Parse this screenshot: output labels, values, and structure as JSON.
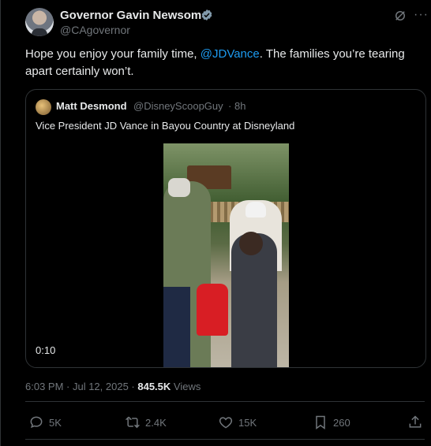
{
  "tweet": {
    "author_name": "Governor Gavin Newsom",
    "author_handle": "@CAgovernor",
    "text_before": "Hope you enjoy your family time, ",
    "mention": "@JDVance",
    "text_after": ". The families you’re tearing apart certainly won’t.",
    "date_time": "6:03 PM · Jul 12, 2025 · ",
    "views_count": "845.5K",
    "views_label": " Views"
  },
  "quote": {
    "author_name": "Matt Desmond",
    "author_handle": "@DisneyScoopGuy",
    "separator": "·",
    "time": "8h",
    "text": "Vice President JD Vance in Bayou Country at Disneyland",
    "video_timestamp": "0:10"
  },
  "actions": {
    "replies": "5K",
    "reposts": "2.4K",
    "likes": "15K",
    "bookmarks": "260"
  },
  "icons": [
    "verified-badge-icon",
    "grok-icon",
    "more-icon",
    "reply-icon",
    "repost-icon",
    "like-icon",
    "bookmark-icon",
    "share-icon"
  ],
  "colors": {
    "accent": "#1d9bf0",
    "muted": "#71767b",
    "text": "#e7e9ea",
    "border": "#2f3336"
  }
}
